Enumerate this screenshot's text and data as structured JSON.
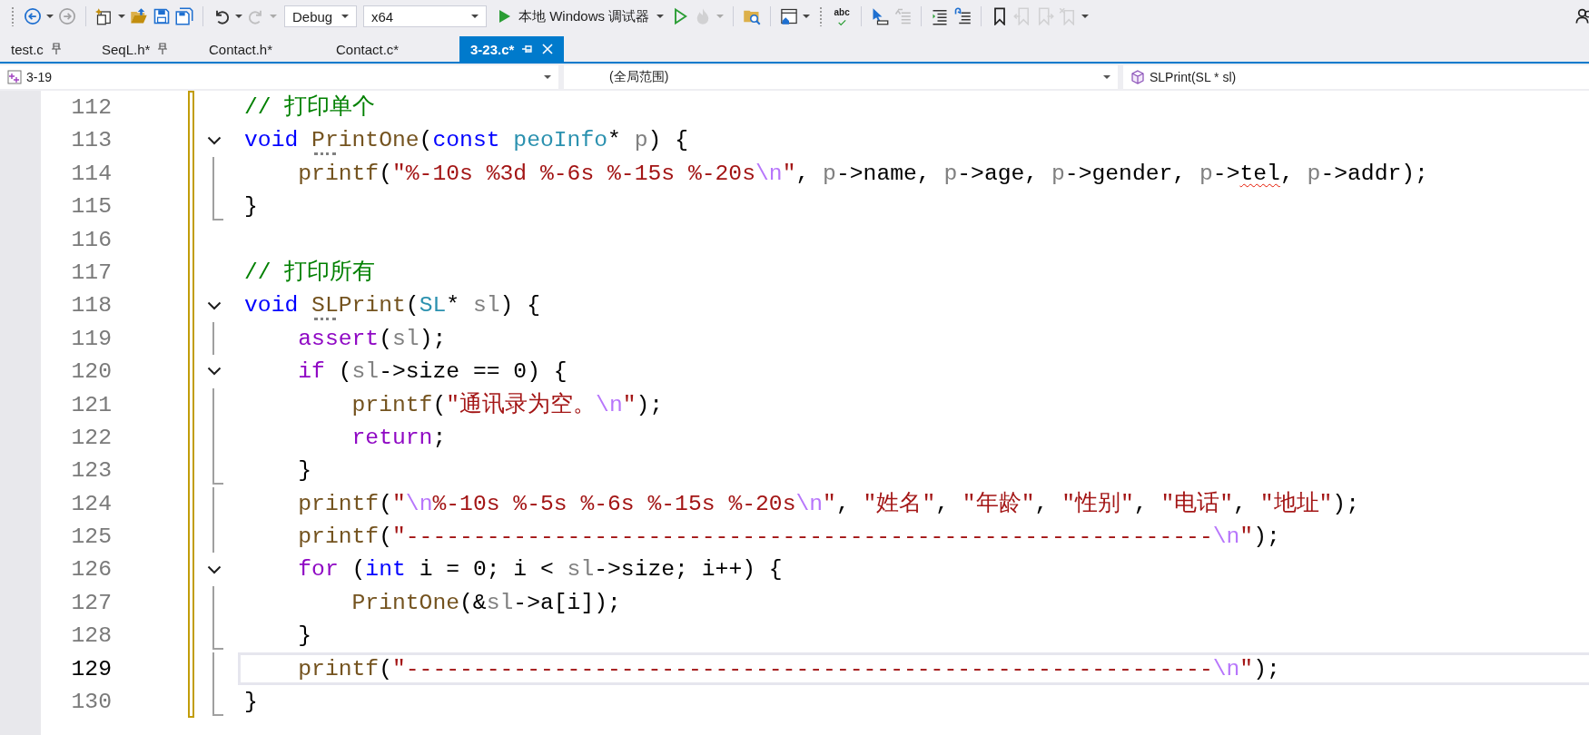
{
  "toolbar": [
    {
      "kind": "grip"
    },
    {
      "kind": "button",
      "disabled": false
    },
    {
      "kind": "caret",
      "disabled": false
    },
    {
      "kind": "button",
      "disabled": true
    },
    {
      "kind": "separator"
    },
    {
      "kind": "button",
      "disabled": false
    },
    {
      "kind": "caret",
      "disabled": false
    },
    {
      "kind": "button",
      "disabled": false
    },
    {
      "kind": "button",
      "disabled": false
    },
    {
      "kind": "button",
      "disabled": false
    },
    {
      "kind": "separator"
    },
    {
      "kind": "button",
      "disabled": false
    },
    {
      "kind": "caret",
      "disabled": false
    },
    {
      "kind": "button",
      "disabled": true
    },
    {
      "kind": "caret",
      "disabled": true
    },
    {
      "kind": "combo",
      "value": "Debug"
    },
    {
      "kind": "combo",
      "value": "x64"
    },
    {
      "kind": "run",
      "label": "本地 Windows 调试器"
    },
    {
      "kind": "button",
      "disabled": false
    },
    {
      "kind": "button",
      "disabled": true
    },
    {
      "kind": "caret",
      "disabled": true
    },
    {
      "kind": "separator"
    },
    {
      "kind": "button",
      "disabled": false
    },
    {
      "kind": "separator"
    },
    {
      "kind": "button",
      "disabled": false
    },
    {
      "kind": "caret",
      "disabled": false
    },
    {
      "kind": "grip"
    },
    {
      "kind": "button",
      "disabled": false,
      "label": "abc"
    },
    {
      "kind": "separator"
    },
    {
      "kind": "button",
      "disabled": false
    },
    {
      "kind": "button",
      "disabled": true
    },
    {
      "kind": "separator"
    },
    {
      "kind": "button",
      "disabled": false
    },
    {
      "kind": "button",
      "disabled": false
    },
    {
      "kind": "separator"
    },
    {
      "kind": "button",
      "disabled": false
    },
    {
      "kind": "button",
      "disabled": true
    },
    {
      "kind": "button",
      "disabled": true
    },
    {
      "kind": "button",
      "disabled": true
    },
    {
      "kind": "caret",
      "disabled": false
    }
  ],
  "tabs": [
    {
      "label": "test.c",
      "selected": false,
      "pinned": true
    },
    {
      "label": "SeqL.h*",
      "selected": false,
      "pinned": true
    },
    {
      "label": "Contact.h*",
      "selected": false,
      "pinned": false
    },
    {
      "label": "Contact.c*",
      "selected": false,
      "pinned": false
    },
    {
      "label": "3-23.c*",
      "selected": true,
      "pinned": true
    }
  ],
  "navigation": {
    "project": "3-19",
    "scope": "(全局范围)",
    "member": "SLPrint(SL * sl)"
  },
  "editor": {
    "lines": [
      {
        "number": "112",
        "kind": "plain",
        "changed": true,
        "current": false,
        "tokens": [
          {
            "kind": "comment",
            "text": "// 打印单个"
          }
        ]
      },
      {
        "number": "113",
        "kind": "opener",
        "changed": true,
        "current": false,
        "tokens": [
          {
            "kind": "keyword",
            "text": "void "
          },
          {
            "kind": "function",
            "text": "PrintOne",
            "hint": true
          },
          {
            "kind": "plain",
            "text": "("
          },
          {
            "kind": "keyword",
            "text": "const "
          },
          {
            "kind": "type",
            "text": "peoInfo"
          },
          {
            "kind": "plain",
            "text": "* "
          },
          {
            "kind": "param",
            "text": "p"
          },
          {
            "kind": "plain",
            "text": ") {"
          }
        ]
      },
      {
        "number": "114",
        "kind": "body",
        "changed": true,
        "current": false,
        "tokens": [
          {
            "kind": "function",
            "text": "    printf"
          },
          {
            "kind": "plain",
            "text": "("
          },
          {
            "kind": "string",
            "text": "\"%-10s %3d %-6s %-15s %-20s"
          },
          {
            "kind": "escape",
            "text": "\\n"
          },
          {
            "kind": "string",
            "text": "\""
          },
          {
            "kind": "plain",
            "text": ", "
          },
          {
            "kind": "param",
            "text": "p"
          },
          {
            "kind": "plain",
            "text": "->name, "
          },
          {
            "kind": "param",
            "text": "p"
          },
          {
            "kind": "plain",
            "text": "->age, "
          },
          {
            "kind": "param",
            "text": "p"
          },
          {
            "kind": "plain",
            "text": "->gender, "
          },
          {
            "kind": "param",
            "text": "p"
          },
          {
            "kind": "plain",
            "text": "->"
          },
          {
            "kind": "plain",
            "text": "tel",
            "error": true
          },
          {
            "kind": "plain",
            "text": ", "
          },
          {
            "kind": "param",
            "text": "p"
          },
          {
            "kind": "plain",
            "text": "->addr);"
          }
        ]
      },
      {
        "number": "115",
        "kind": "closer",
        "changed": true,
        "current": false,
        "tokens": [
          {
            "kind": "plain",
            "text": "}"
          }
        ]
      },
      {
        "number": "116",
        "kind": "plain",
        "changed": true,
        "current": false
      },
      {
        "number": "117",
        "kind": "plain",
        "changed": true,
        "current": false,
        "tokens": [
          {
            "kind": "comment",
            "text": "// 打印所有"
          }
        ]
      },
      {
        "number": "118",
        "kind": "opener",
        "changed": true,
        "current": false,
        "tokens": [
          {
            "kind": "keyword",
            "text": "void "
          },
          {
            "kind": "function",
            "text": "SLPrint",
            "hint": true
          },
          {
            "kind": "plain",
            "text": "("
          },
          {
            "kind": "type",
            "text": "SL"
          },
          {
            "kind": "plain",
            "text": "* "
          },
          {
            "kind": "param",
            "text": "sl"
          },
          {
            "kind": "plain",
            "text": ") {"
          }
        ]
      },
      {
        "number": "119",
        "kind": "body",
        "changed": true,
        "current": false,
        "tokens": [
          {
            "kind": "macro",
            "text": "    assert"
          },
          {
            "kind": "plain",
            "text": "("
          },
          {
            "kind": "param",
            "text": "sl"
          },
          {
            "kind": "plain",
            "text": ");"
          }
        ]
      },
      {
        "number": "120",
        "kind": "opener",
        "changed": true,
        "current": false,
        "tokens": [
          {
            "kind": "control",
            "text": "    if"
          },
          {
            "kind": "plain",
            "text": " ("
          },
          {
            "kind": "param",
            "text": "sl"
          },
          {
            "kind": "plain",
            "text": "->size == 0) {"
          }
        ]
      },
      {
        "number": "121",
        "kind": "body",
        "changed": true,
        "current": false,
        "tokens": [
          {
            "kind": "function",
            "text": "        printf"
          },
          {
            "kind": "plain",
            "text": "("
          },
          {
            "kind": "string",
            "text": "\"通讯录为空。"
          },
          {
            "kind": "escape",
            "text": "\\n"
          },
          {
            "kind": "string",
            "text": "\""
          },
          {
            "kind": "plain",
            "text": ");"
          }
        ]
      },
      {
        "number": "122",
        "kind": "body",
        "changed": true,
        "current": false,
        "tokens": [
          {
            "kind": "control",
            "text": "        return"
          },
          {
            "kind": "plain",
            "text": ";"
          }
        ]
      },
      {
        "number": "123",
        "kind": "closer",
        "changed": true,
        "current": false,
        "tokens": [
          {
            "kind": "plain",
            "text": "    }"
          }
        ]
      },
      {
        "number": "124",
        "kind": "body",
        "changed": true,
        "current": false,
        "tokens": [
          {
            "kind": "function",
            "text": "    printf"
          },
          {
            "kind": "plain",
            "text": "("
          },
          {
            "kind": "string",
            "text": "\""
          },
          {
            "kind": "escape",
            "text": "\\n"
          },
          {
            "kind": "string",
            "text": "%-10s %-5s %-6s %-15s %-20s"
          },
          {
            "kind": "escape",
            "text": "\\n"
          },
          {
            "kind": "string",
            "text": "\""
          },
          {
            "kind": "plain",
            "text": ", "
          },
          {
            "kind": "string",
            "text": "\"姓名\""
          },
          {
            "kind": "plain",
            "text": ", "
          },
          {
            "kind": "string",
            "text": "\"年龄\""
          },
          {
            "kind": "plain",
            "text": ", "
          },
          {
            "kind": "string",
            "text": "\"性别\""
          },
          {
            "kind": "plain",
            "text": ", "
          },
          {
            "kind": "string",
            "text": "\"电话\""
          },
          {
            "kind": "plain",
            "text": ", "
          },
          {
            "kind": "string",
            "text": "\"地址\""
          },
          {
            "kind": "plain",
            "text": ");"
          }
        ]
      },
      {
        "number": "125",
        "kind": "body",
        "changed": true,
        "current": false,
        "tokens": [
          {
            "kind": "function",
            "text": "    printf"
          },
          {
            "kind": "plain",
            "text": "("
          },
          {
            "kind": "string",
            "text": "\"------------------------------------------------------------"
          },
          {
            "kind": "escape",
            "text": "\\n"
          },
          {
            "kind": "string",
            "text": "\""
          },
          {
            "kind": "plain",
            "text": ");"
          }
        ]
      },
      {
        "number": "126",
        "kind": "opener",
        "changed": true,
        "current": false,
        "tokens": [
          {
            "kind": "control",
            "text": "    for"
          },
          {
            "kind": "plain",
            "text": " ("
          },
          {
            "kind": "keyword",
            "text": "int"
          },
          {
            "kind": "plain",
            "text": " i = 0; i < "
          },
          {
            "kind": "param",
            "text": "sl"
          },
          {
            "kind": "plain",
            "text": "->size; i++) {"
          }
        ]
      },
      {
        "number": "127",
        "kind": "body",
        "changed": true,
        "current": false,
        "tokens": [
          {
            "kind": "function",
            "text": "        PrintOne"
          },
          {
            "kind": "plain",
            "text": "(&"
          },
          {
            "kind": "param",
            "text": "sl"
          },
          {
            "kind": "plain",
            "text": "->a[i]);"
          }
        ]
      },
      {
        "number": "128",
        "kind": "closer",
        "changed": true,
        "current": false,
        "tokens": [
          {
            "kind": "plain",
            "text": "    }"
          }
        ]
      },
      {
        "number": "129",
        "kind": "body",
        "changed": true,
        "current": true,
        "tokens": [
          {
            "kind": "function",
            "text": "    printf"
          },
          {
            "kind": "plain",
            "text": "("
          },
          {
            "kind": "string",
            "text": "\"------------------------------------------------------------"
          },
          {
            "kind": "escape",
            "text": "\\n"
          },
          {
            "kind": "string",
            "text": "\""
          },
          {
            "kind": "plain",
            "text": ");"
          }
        ]
      },
      {
        "number": "130",
        "kind": "closer",
        "changed": true,
        "current": false,
        "tokens": [
          {
            "kind": "plain",
            "text": "}"
          }
        ]
      }
    ]
  }
}
